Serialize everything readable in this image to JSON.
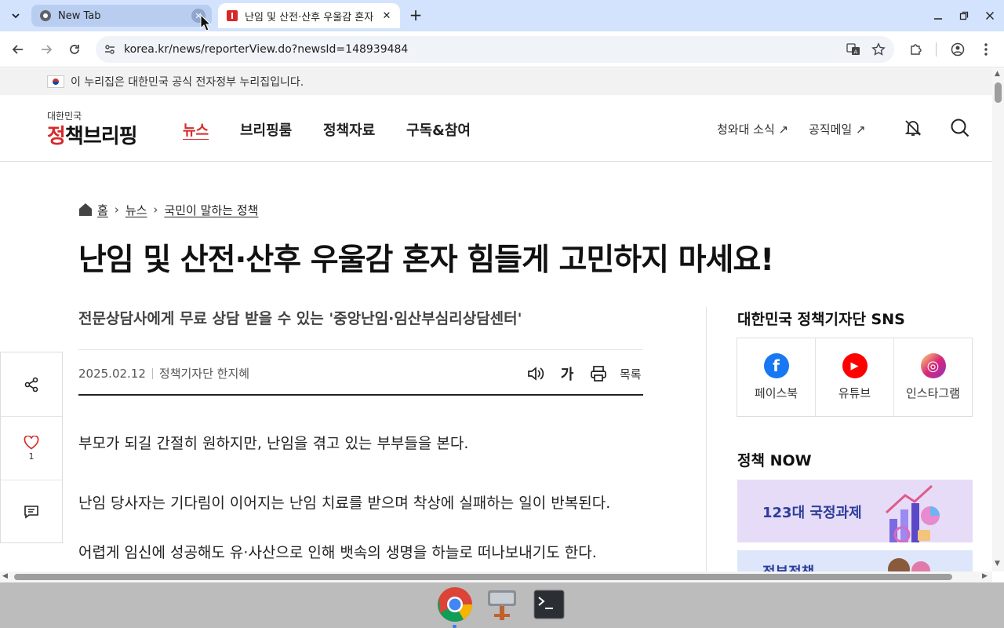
{
  "browser": {
    "tabs": [
      {
        "title": "New Tab",
        "active": false
      },
      {
        "title": "난임 및 산전·산후 우울감 혼자",
        "active": true
      }
    ],
    "url": "korea.kr/news/reporterView.do?newsId=148939484"
  },
  "gov_banner": {
    "text": "이 누리집은 대한민국 공식 전자정부 누리집입니다."
  },
  "header": {
    "logo_small": "대한민국",
    "logo_red": "정",
    "logo_rest": "책브리핑",
    "nav": [
      "뉴스",
      "브리핑룸",
      "정책자료",
      "구독&참여"
    ],
    "util_links": [
      "청와대 소식 ↗",
      "공직메일 ↗"
    ]
  },
  "breadcrumb": {
    "home": "홈",
    "level1": "뉴스",
    "level2": "국민이 말하는 정책"
  },
  "article": {
    "title": "난임 및 산전·산후 우울감 혼자 힘들게 고민하지 마세요!",
    "subtitle": "전문상담사에게 무료 상담 받을 수 있는 '중앙난임·임산부심리상담센터'",
    "date": "2025.02.12",
    "author": "정책기자단 한지혜",
    "font_size_label": "가",
    "list_label": "목록",
    "paragraphs": [
      "부모가 되길 간절히 원하지만, 난임을 겪고 있는 부부들을 본다.",
      "난임 당사자는 기다림이 이어지는 난임 치료를 받으며 착상에 실패하는 일이 반복된다.",
      "어렵게 임신에 성공해도 유·사산으로 인해 뱃속의 생명을 하늘로 떠나보내기도 한다."
    ]
  },
  "side_rail": {
    "like_count": "1"
  },
  "sidebar": {
    "sns_title": "대한민국 정책기자단 SNS",
    "sns": [
      {
        "label": "페이스북",
        "glyph": "f",
        "color": "#1877f2"
      },
      {
        "label": "유튜브",
        "glyph": "▶",
        "color": "#ff0000"
      },
      {
        "label": "인스타그램",
        "glyph": "◎",
        "color": "#e1306c"
      }
    ],
    "now_title": "정책 NOW",
    "banners": [
      "123대 국정과제",
      "정부정책"
    ]
  },
  "colors": {
    "accent": "#d62a2a",
    "chrome_tabstrip": "#d3e3fd"
  }
}
